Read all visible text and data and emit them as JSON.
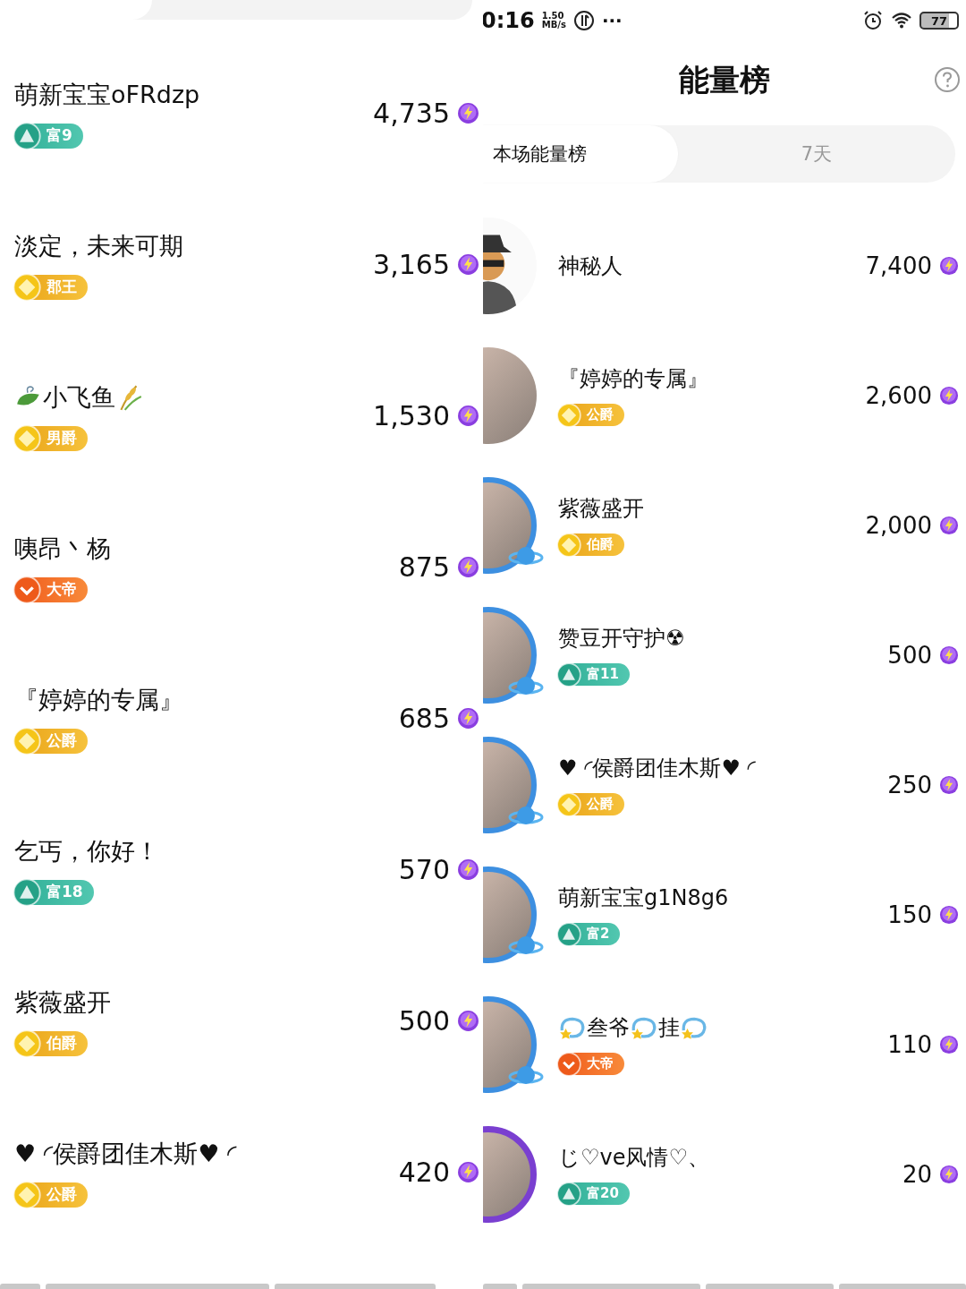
{
  "left_panel": {
    "rows": [
      {
        "name": "萌新宝宝oFRdzp",
        "badge": {
          "kind": "rich",
          "label": "富9"
        },
        "energy": "4,735"
      },
      {
        "name": "淡定，未来可期",
        "badge": {
          "kind": "gold",
          "label": "郡王"
        },
        "energy": "3,165"
      },
      {
        "name_parts": [
          {
            "kind": "leaf"
          },
          {
            "kind": "text",
            "text": "小飞鱼"
          },
          {
            "kind": "wheat"
          }
        ],
        "badge": {
          "kind": "gold",
          "label": "男爵"
        },
        "energy": "1,530"
      },
      {
        "name": "咦昂丶杨",
        "badge": {
          "kind": "orange",
          "label": "大帝"
        },
        "energy": "875"
      },
      {
        "name": "『婷婷的专属』",
        "badge": {
          "kind": "gold",
          "label": "公爵"
        },
        "energy": "685"
      },
      {
        "name": "乞丐，你好！",
        "badge": {
          "kind": "rich",
          "label": "富18"
        },
        "energy": "570"
      },
      {
        "name": "紫薇盛开",
        "badge": {
          "kind": "gold",
          "label": "伯爵"
        },
        "energy": "500"
      },
      {
        "name": "♥ ◜侯爵团佳木斯♥ ◜",
        "badge": {
          "kind": "gold",
          "label": "公爵"
        },
        "energy": "420"
      }
    ]
  },
  "right_panel": {
    "status_bar": {
      "time": "0:16",
      "net_speed": "1.50",
      "net_unit": "MB/s",
      "more": "···",
      "battery": "77"
    },
    "title": "能量榜",
    "tabs": [
      {
        "label": "本场能量榜",
        "selected": true
      },
      {
        "label": "7天",
        "selected": false
      }
    ],
    "rows": [
      {
        "avatar": {
          "kind": "silhouette"
        },
        "name": "神秘人",
        "energy": "7,400"
      },
      {
        "avatar": {
          "kind": "photo"
        },
        "name": "『婷婷的专属』",
        "badge": {
          "kind": "gold",
          "label": "公爵"
        },
        "energy": "2,600"
      },
      {
        "avatar": {
          "kind": "planet"
        },
        "name": "紫薇盛开",
        "badge": {
          "kind": "gold",
          "label": "伯爵"
        },
        "energy": "2,000"
      },
      {
        "avatar": {
          "kind": "planet"
        },
        "name": "赞豆开守护☢",
        "badge": {
          "kind": "rich",
          "label": "富11"
        },
        "energy": "500"
      },
      {
        "avatar": {
          "kind": "planet"
        },
        "name": "♥ ◜侯爵团佳木斯♥ ◜",
        "badge": {
          "kind": "gold",
          "label": "公爵"
        },
        "energy": "250"
      },
      {
        "avatar": {
          "kind": "planet"
        },
        "name": "萌新宝宝g1N8g6",
        "badge": {
          "kind": "rich",
          "label": "富2"
        },
        "energy": "150"
      },
      {
        "avatar": {
          "kind": "planet"
        },
        "name_parts": [
          {
            "kind": "swirl"
          },
          {
            "kind": "text",
            "text": "叁爷"
          },
          {
            "kind": "swirl"
          },
          {
            "kind": "text",
            "text": "挂"
          },
          {
            "kind": "swirl"
          }
        ],
        "badge": {
          "kind": "orange",
          "label": "大帝"
        },
        "energy": "110"
      },
      {
        "avatar": {
          "kind": "crystal"
        },
        "name": "じ♡ve风情♡、",
        "badge": {
          "kind": "rich",
          "label": "富20"
        },
        "energy": "20"
      }
    ]
  }
}
